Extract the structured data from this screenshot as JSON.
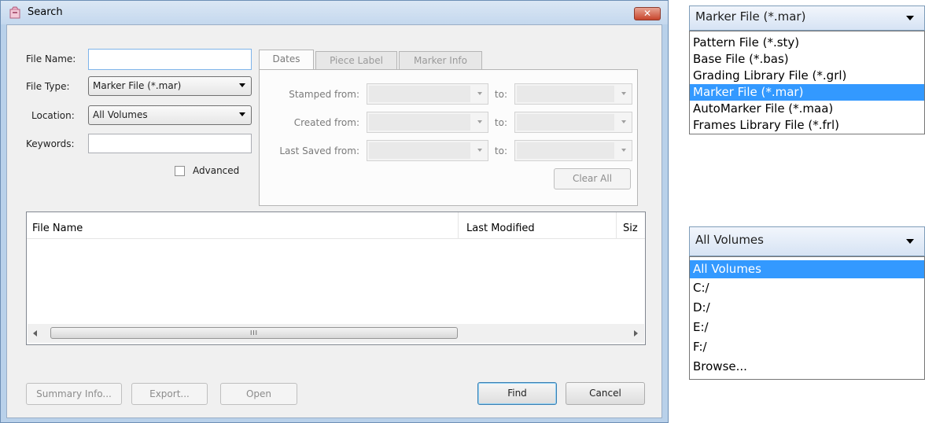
{
  "dialog": {
    "title": "Search",
    "close_glyph": "✕",
    "form": {
      "file_name_label": "File Name:",
      "file_name_value": "",
      "file_type_label": "File Type:",
      "file_type_value": "Marker File (*.mar)",
      "location_label": "Location:",
      "location_value": "All Volumes",
      "keywords_label": "Keywords:",
      "keywords_value": "",
      "advanced_label": "Advanced",
      "advanced_checked": false
    },
    "tabs": [
      {
        "label": "Dates",
        "active": true
      },
      {
        "label": "Piece Label",
        "active": false
      },
      {
        "label": "Marker Info",
        "active": false
      }
    ],
    "dates": {
      "stamped_from": "Stamped from:",
      "created_from": "Created from:",
      "last_saved_from": "Last Saved from:",
      "to": "to:",
      "clear_all": "Clear All"
    },
    "results": {
      "columns": [
        "File Name",
        "Last Modified",
        "Siz"
      ],
      "rows": [],
      "scroll_grip": "III"
    },
    "buttons": {
      "summary_info": "Summary Info...",
      "export": "Export...",
      "open": "Open",
      "find": "Find",
      "cancel": "Cancel"
    }
  },
  "file_type_dropdown": {
    "selected": "Marker File (*.mar)",
    "options": [
      "Pattern File (*.sty)",
      "Base File (*.bas)",
      "Grading Library File (*.grl)",
      "Marker File (*.mar)",
      "AutoMarker File (*.maa)",
      "Frames Library File (*.frl)"
    ],
    "highlighted_index": 3
  },
  "location_dropdown": {
    "selected": "All Volumes",
    "options": [
      "All Volumes",
      "C:/",
      "D:/",
      "E:/",
      "F:/",
      "Browse..."
    ],
    "highlighted_index": 0
  },
  "icons": {
    "app": "app-icon",
    "close": "close-icon",
    "dropdown": "chevron-down-icon",
    "scroll_left": "scroll-left-icon",
    "scroll_right": "scroll-right-icon"
  },
  "colors": {
    "selection": "#3399ff",
    "window_frame": "#b9d1ea",
    "close_button": "#c7452c"
  }
}
